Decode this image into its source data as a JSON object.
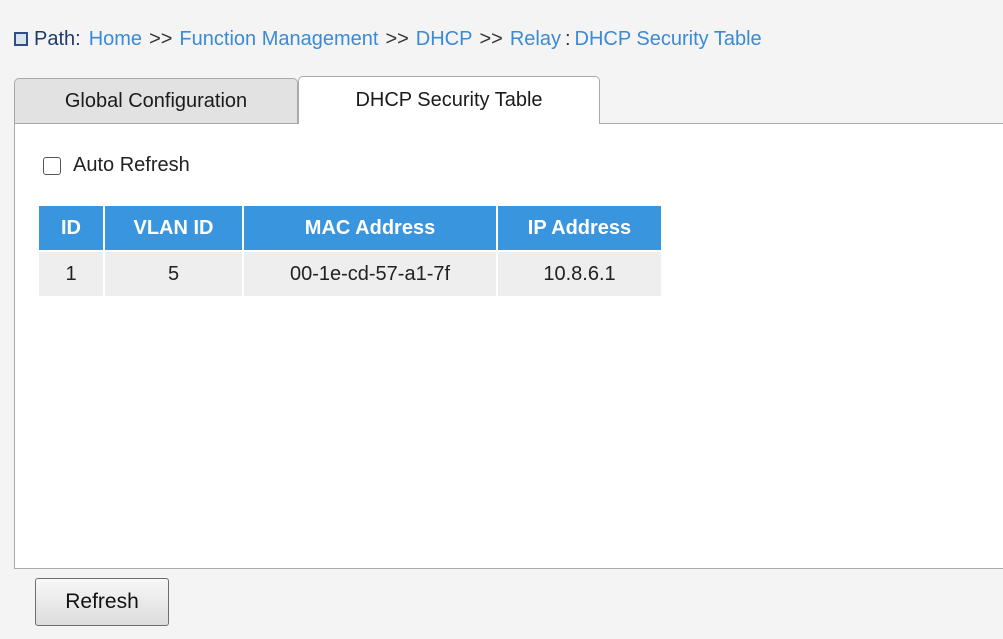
{
  "path": {
    "label": "Path:",
    "crumbs": [
      "Home",
      "Function Management",
      "DHCP",
      "Relay",
      "DHCP Security Table"
    ],
    "separator": ">>",
    "last_separator": ":"
  },
  "tabs": [
    {
      "label": "Global Configuration",
      "active": false
    },
    {
      "label": "DHCP Security Table",
      "active": true
    }
  ],
  "auto_refresh": {
    "label": "Auto Refresh",
    "checked": false
  },
  "table": {
    "headers": [
      "ID",
      "VLAN ID",
      "MAC Address",
      "IP Address"
    ],
    "rows": [
      [
        "1",
        "5",
        "00-1e-cd-57-a1-7f",
        "10.8.6.1"
      ]
    ]
  },
  "buttons": {
    "refresh": "Refresh"
  },
  "colors": {
    "header_bg": "#3a95df",
    "link": "#3a8ad6",
    "cell_bg": "#eeeeee"
  }
}
